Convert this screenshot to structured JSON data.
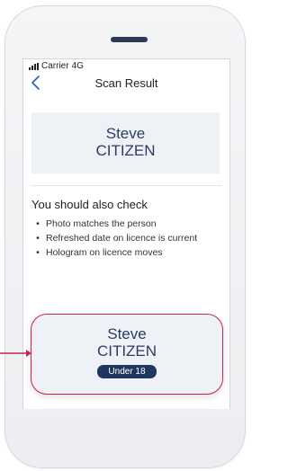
{
  "status_bar": {
    "carrier": "Carrier",
    "network": "4G"
  },
  "nav": {
    "title": "Scan Result",
    "back_icon": "chevron-left-icon"
  },
  "result_card": {
    "first_name": "Steve",
    "last_name": "CITIZEN"
  },
  "checks": {
    "heading": "You should also check",
    "items": [
      "Photo matches the person",
      "Refreshed date on licence is current",
      "Hologram on licence moves"
    ]
  },
  "highlight_card": {
    "first_name": "Steve",
    "last_name": "CITIZEN",
    "badge": "Under 18"
  },
  "colors": {
    "accent_red": "#c8234a",
    "navy": "#2a3d63",
    "badge_bg": "#1f3760",
    "card_bg": "#eef1f6"
  }
}
